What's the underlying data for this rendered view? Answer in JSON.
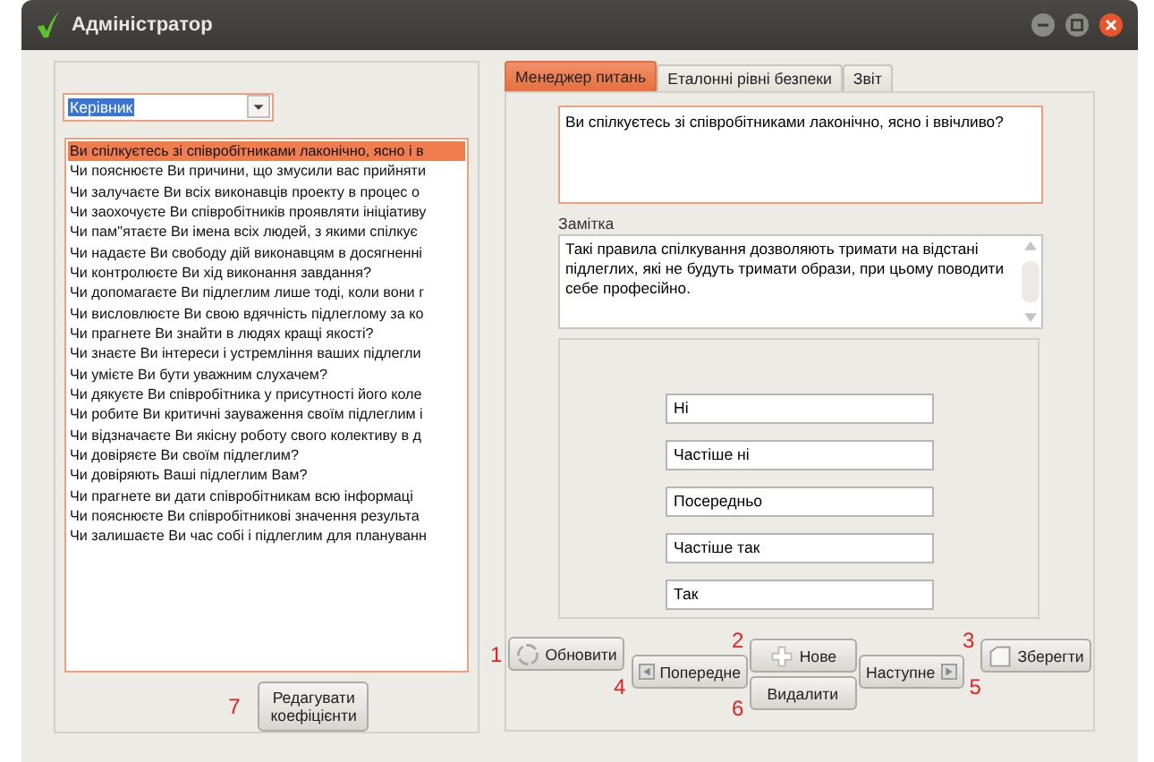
{
  "window": {
    "title": "Адміністратор"
  },
  "role_dropdown": {
    "value": "Керівник"
  },
  "questions": [
    {
      "text": "Ви спілкуєтесь зі співробітниками лаконічно, ясно і в",
      "selected": true
    },
    {
      "text": "Чи пояснюєте Ви причини, що змусили вас прийняти",
      "selected": false
    },
    {
      "text": "Чи залучаєте Ви всіх виконавців проекту в процес о",
      "selected": false
    },
    {
      "text": "Чи заохочуєте Ви співробітників проявляти ініціативу",
      "selected": false
    },
    {
      "text": "Чи пам\"ятаєте Ви імена всіх людей, з якими спілкує",
      "selected": false
    },
    {
      "text": "Чи надаєте Ви свободу дій виконавцям в досягненні",
      "selected": false
    },
    {
      "text": "Чи контролюєте Ви хід виконання завдання?",
      "selected": false
    },
    {
      "text": "Чи допомагаєте Ви підлеглим лише тоді, коли вони г",
      "selected": false
    },
    {
      "text": "Чи висловлюєте Ви свою вдячність підлеглому за ко",
      "selected": false
    },
    {
      "text": "Чи прагнете Ви знайти в людях кращі якості?",
      "selected": false
    },
    {
      "text": "Чи знаєте Ви інтереси і устремління ваших підлегли",
      "selected": false
    },
    {
      "text": "Чи умієте Ви бути уважним слухачем?",
      "selected": false
    },
    {
      "text": "Чи дякуєте Ви співробітника у присутності його коле",
      "selected": false
    },
    {
      "text": "Чи робите Ви критичні зауваження своїм підлеглим і",
      "selected": false
    },
    {
      "text": "Чи відзначаєте Ви якісну роботу свого колективу в д",
      "selected": false
    },
    {
      "text": "Чи довіряєте Ви своїм підлеглим?",
      "selected": false
    },
    {
      "text": "Чи довіряють Ваші підлеглим Вам?",
      "selected": false
    },
    {
      "text": "Чи прагнете ви дати співробітникам всю інформаці",
      "selected": false
    },
    {
      "text": "Чи пояснюєте Ви співробітникові значення результа",
      "selected": false
    },
    {
      "text": "Чи залишаєте Ви час собі і підлеглим для плануванн",
      "selected": false
    }
  ],
  "edit_button": {
    "label": "Редагувати коефіцієнти",
    "marker": "7"
  },
  "tabs": [
    {
      "label": "Менеджер питань",
      "selected": true
    },
    {
      "label": "Еталонні рівні безпеки",
      "selected": false
    },
    {
      "label": "Звіт",
      "selected": false
    }
  ],
  "question_field": {
    "value": "Ви спілкуєтесь зі співробітниками лаконічно, ясно і ввічливо?"
  },
  "note": {
    "label": "Замітка",
    "value": "Такі правила спілкування дозволяють тримати на відстані підлеглих, які не будуть тримати образи, при цьому поводити себе професійно."
  },
  "answers": [
    "Ні",
    "Частіше ні",
    "Посередньо",
    "Частіше так",
    "Так"
  ],
  "buttons": [
    {
      "kind": "refresh",
      "label": "Обновити",
      "marker": "1"
    },
    {
      "kind": "prev",
      "label": "Попередне",
      "marker": "4"
    },
    {
      "kind": "new",
      "label": "Нове",
      "marker": "2"
    },
    {
      "kind": "delete",
      "label": "Видалити",
      "marker": "6"
    },
    {
      "kind": "next",
      "label": "Наступне",
      "marker": "5"
    },
    {
      "kind": "save",
      "label": "Зберегти",
      "marker": "3"
    }
  ]
}
